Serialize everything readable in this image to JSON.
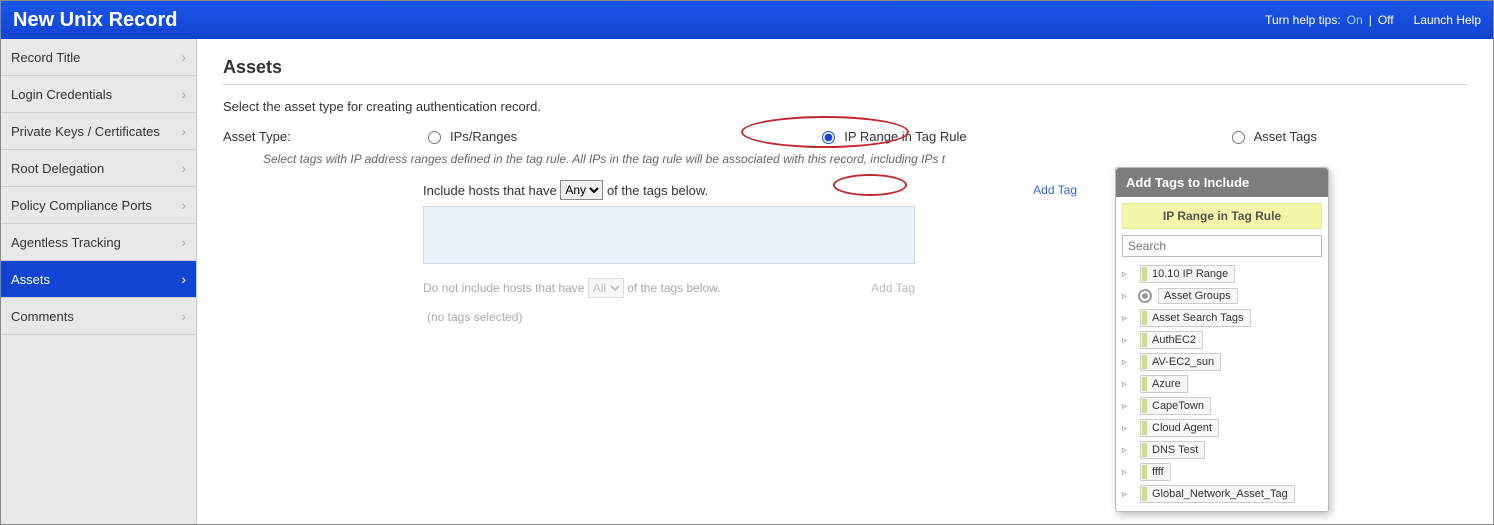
{
  "window_title": "New Unix Record",
  "help": {
    "label": "Turn help tips:",
    "on": "On",
    "off": "Off",
    "launch": "Launch Help"
  },
  "sidebar": {
    "items": [
      {
        "label": "Record Title"
      },
      {
        "label": "Login Credentials"
      },
      {
        "label": "Private Keys / Certificates"
      },
      {
        "label": "Root Delegation"
      },
      {
        "label": "Policy Compliance Ports"
      },
      {
        "label": "Agentless Tracking"
      },
      {
        "label": "Assets"
      },
      {
        "label": "Comments"
      }
    ],
    "active_index": 6
  },
  "main": {
    "heading": "Assets",
    "subtitle": "Select the asset type for creating authentication record.",
    "asset_type_label": "Asset Type:",
    "radios": {
      "ips": "IPs/Ranges",
      "tagrule": "IP Range in Tag Rule",
      "assettags": "Asset Tags",
      "selected": "tagrule"
    },
    "hint": "Select tags with IP address ranges defined in the tag rule. All IPs in the tag rule will be associated with this record, including IPs t",
    "include_prefix": "Include hosts that have",
    "include_suffix": "of the tags below.",
    "include_select": "Any",
    "add_tag": "Add Tag",
    "exclude_prefix": "Do not include hosts that have",
    "exclude_select": "All",
    "exclude_suffix": "of the tags below.",
    "exclude_add": "Add Tag",
    "no_tags": "(no tags selected)"
  },
  "popup": {
    "title": "Add Tags to Include",
    "sub": "IP Range in Tag Rule",
    "search_placeholder": "Search",
    "items": [
      {
        "label": "10.10 IP Range",
        "dot": false
      },
      {
        "label": "Asset Groups",
        "dot": true
      },
      {
        "label": "Asset Search Tags",
        "dot": false
      },
      {
        "label": "AuthEC2",
        "dot": false
      },
      {
        "label": "AV-EC2_sun",
        "dot": false
      },
      {
        "label": "Azure",
        "dot": false
      },
      {
        "label": "CapeTown",
        "dot": false
      },
      {
        "label": "Cloud Agent",
        "dot": false
      },
      {
        "label": "DNS Test",
        "dot": false
      },
      {
        "label": "ffff",
        "dot": false
      },
      {
        "label": "Global_Network_Asset_Tag",
        "dot": false
      }
    ]
  }
}
